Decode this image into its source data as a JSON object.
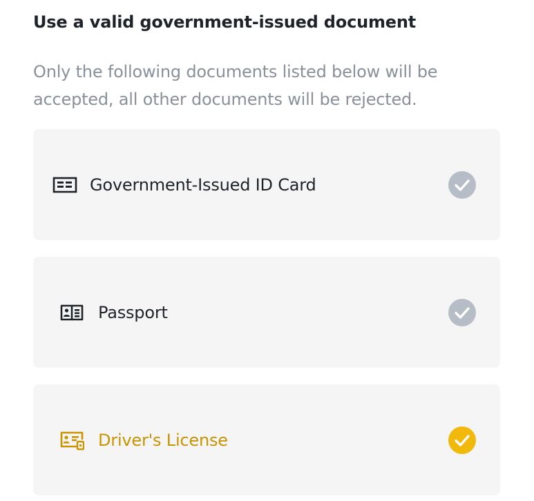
{
  "header": {
    "title": "Use a valid government-issued document",
    "subtitle": "Only the following documents listed below will be accepted, all other documents will be rejected."
  },
  "documents": [
    {
      "label": "Government-Issued ID Card",
      "icon": "id-card-icon",
      "selected": false
    },
    {
      "label": "Passport",
      "icon": "passport-icon",
      "selected": false
    },
    {
      "label": "Driver's License",
      "icon": "drivers-license-icon",
      "selected": true
    }
  ],
  "colors": {
    "text_primary": "#1e2329",
    "text_secondary": "#8a9099",
    "card_background": "#f5f5f5",
    "check_unselected": "#b7bdc6",
    "accent_selected": "#f0b90b",
    "selected_text": "#c99400"
  }
}
